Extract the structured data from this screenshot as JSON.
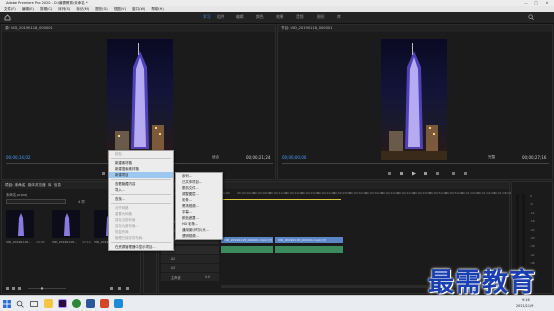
{
  "window": {
    "title": "Adobe Premiere Pro 2020 - D:\\最需教育\\未命名 *",
    "controls": [
      "—",
      "□",
      "✕"
    ]
  },
  "menu": [
    "文件(F)",
    "编辑(E)",
    "剪辑(C)",
    "序列(S)",
    "标记(M)",
    "图形(G)",
    "视图(V)",
    "窗口(W)",
    "帮助(H)"
  ],
  "workspaces": {
    "home_icon": "home-icon",
    "tabs": [
      "学习",
      "组件",
      "编辑",
      "颜色",
      "效果",
      "音频",
      "图形",
      "库"
    ],
    "active": "学习"
  },
  "source_monitor": {
    "title": "源: VID_20190118_000001",
    "timecode_in": "00;00;14;02",
    "timecode_out": "00;00;21;24",
    "fit": "适合"
  },
  "program_monitor": {
    "title": "节目: VID_20190118_000001",
    "timecode": "00;00;00;00",
    "fit": "完整",
    "duration": "00;00;27;16"
  },
  "project_panel": {
    "tabs": [
      "项目: 未命名",
      "媒体浏览器",
      "库",
      "信息"
    ],
    "path": "未命名.prproj",
    "count": "4 项",
    "thumbs": [
      {
        "label": "VID_20190118...",
        "meta": "14:02"
      },
      {
        "label": "VID_20190118...",
        "meta": "12:14"
      },
      {
        "label": "VID_20190118...",
        "meta": "5:02"
      }
    ]
  },
  "context_menu": {
    "items": [
      {
        "label": "粘贴",
        "state": "disabled"
      },
      {
        "label": "新建素材箱",
        "state": "normal"
      },
      {
        "label": "新建搜索素材箱",
        "state": "normal"
      },
      {
        "label": "新建项目",
        "state": "highlight"
      },
      {
        "label": "查看隐藏内容",
        "state": "normal"
      },
      {
        "label": "导入...",
        "state": "normal"
      },
      {
        "label": "查找...",
        "state": "normal"
      },
      {
        "label": "对齐网格",
        "state": "disabled"
      },
      {
        "label": "重置为网格",
        "state": "disabled"
      },
      {
        "label": "保存当前布局",
        "state": "disabled"
      },
      {
        "label": "另存为新布局...",
        "state": "disabled"
      },
      {
        "label": "恢复布局",
        "state": "disabled"
      },
      {
        "label": "管理已保存的布局...",
        "state": "disabled"
      },
      {
        "label": "在资源管理器中显示项目...",
        "state": "normal"
      }
    ]
  },
  "submenu": {
    "items": [
      "序列...",
      "已共享项目...",
      "脱机文件...",
      "调整图层...",
      "彩条...",
      "黑场视频...",
      "字幕...",
      "颜色遮罩...",
      "HD 彩条...",
      "通用倒计时片头...",
      "透明视频..."
    ]
  },
  "timeline": {
    "sequence_title": "× VID_20190118_000001 ≡",
    "timecode": "00;00;00;00",
    "ruler": [
      "00;00",
      "00;00;04;00",
      "00;00;08;00",
      "00;00;12;00",
      "00;00;16;00",
      "00;00;20;00",
      "00;00;24;00",
      "00;00;28;00",
      "00;00;32;00",
      "00;00;36;00",
      "00;00;40;00",
      "00;00;44;00",
      "00;00;48;00",
      "00;00;52;00",
      "00;00;56;00",
      "00;01;00;02",
      "00;01;04;02",
      "00;01;08;02"
    ],
    "tracks": [
      "V3",
      "V2",
      "V1",
      "A1",
      "A2",
      "A3",
      "主声道"
    ],
    "master_value": "0.0",
    "clips": [
      {
        "label": "VID_20190118_000001.mp4 [V]"
      },
      {
        "label": "VID_20190118_000001.mp4 [V]"
      }
    ],
    "meter_scale": [
      "0",
      "-6",
      "-12",
      "-18",
      "-24",
      "-30",
      "-36",
      "-42",
      "-48",
      "-54",
      "dB"
    ]
  },
  "taskbar": {
    "time": "9:16",
    "date": "2021/11/9"
  },
  "watermark": "最需教育",
  "colors": {
    "accent": "#4a90e2",
    "timecode": "#4a9eff",
    "clip_video": "#5b86c6",
    "clip_audio": "#3d8a5e",
    "menu_highlight": "#9cc8f0",
    "watermark": "#1a3fb0"
  }
}
